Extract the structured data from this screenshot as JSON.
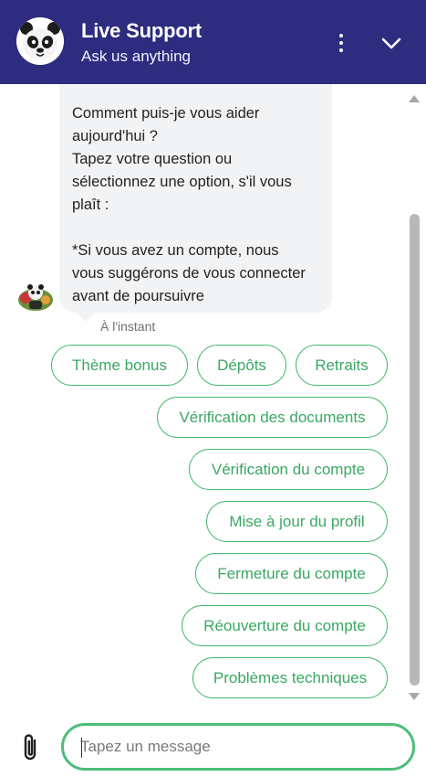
{
  "header": {
    "title": "Live Support",
    "subtitle": "Ask us anything",
    "menu_icon": "kebab-menu-icon",
    "collapse_icon": "chevron-down-icon",
    "colors": {
      "background": "#2e2c7e",
      "text": "#ffffff"
    }
  },
  "message": {
    "text": "Comment puis-je vous aider\naujourd'hui ?\nTapez votre question ou\nsélectionnez une option, s'il vous\nplaît :\n\n*Si vous avez un compte, nous\nvous suggérons de vous connecter\navant de poursuivre",
    "timestamp": "À l'instant"
  },
  "quick_replies": [
    "Thème bonus",
    "Dépôts",
    "Retraits",
    "Vérification des documents",
    "Vérification du compte",
    "Mise à jour du profil",
    "Fermeture du compte",
    "Réouverture du compte",
    "Problèmes techniques"
  ],
  "composer": {
    "placeholder": "Tapez un message",
    "value": "",
    "attach_icon": "paperclip-icon"
  },
  "colors": {
    "accent": "#42b86e",
    "bubble": "#f2f3f5"
  }
}
